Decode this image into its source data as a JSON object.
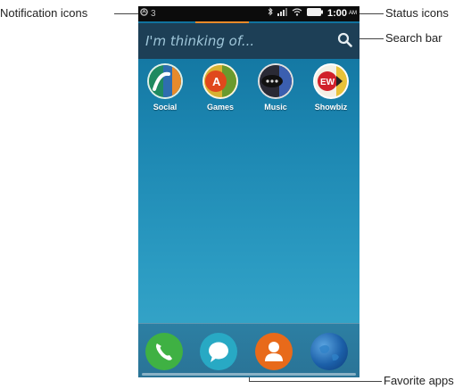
{
  "status_bar": {
    "notification_count": "3",
    "time": "1:00",
    "ampm": "AM"
  },
  "search": {
    "placeholder": "I'm thinking of..."
  },
  "apps": [
    {
      "label": "Social",
      "icon": "social-icon"
    },
    {
      "label": "Games",
      "icon": "games-icon"
    },
    {
      "label": "Music",
      "icon": "music-icon"
    },
    {
      "label": "Showbiz",
      "icon": "showbiz-icon"
    }
  ],
  "dock": [
    {
      "icon": "phone-icon",
      "color": "#3fb143"
    },
    {
      "icon": "messages-icon",
      "color": "#28a9c4"
    },
    {
      "icon": "contacts-icon",
      "color": "#e86a1a"
    },
    {
      "icon": "browser-icon",
      "color": "#1b5fa8"
    }
  ],
  "callouts": {
    "notification_icons": "Notification icons",
    "status_icons": "Status icons",
    "search_bar": "Search bar",
    "favorite_apps": "Favorite apps"
  },
  "colors": {
    "statusbar_bg": "#0c0c0c",
    "searchbar_bg": "#1d3f56",
    "accent_orange": "#e88a2a"
  }
}
